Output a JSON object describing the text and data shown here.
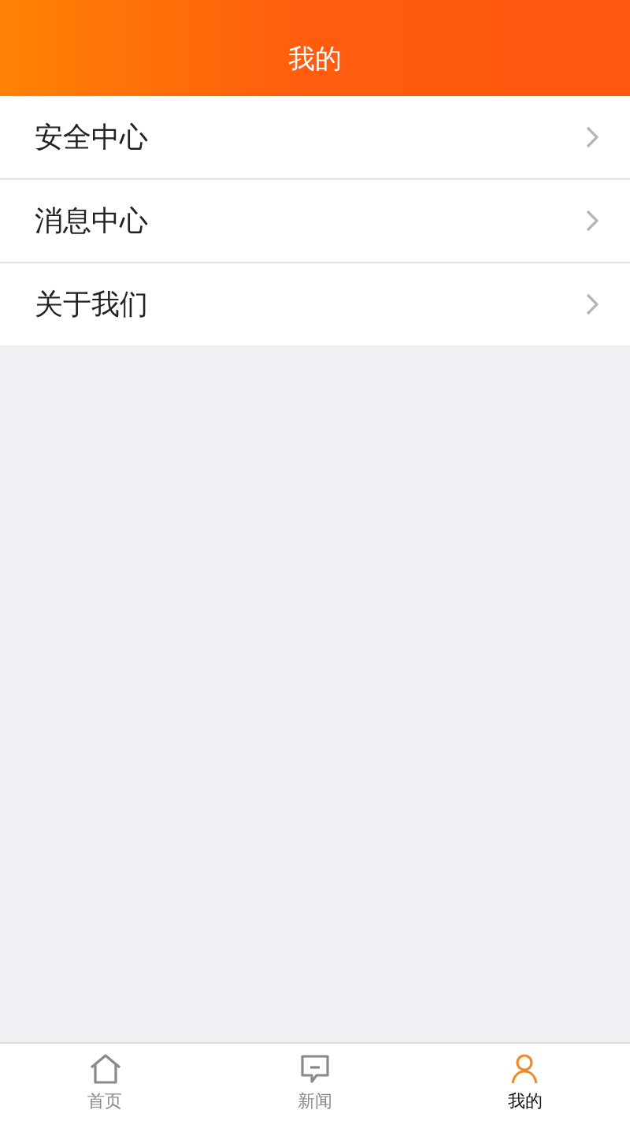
{
  "header": {
    "title": "我的"
  },
  "menu": [
    {
      "label": "安全中心"
    },
    {
      "label": "消息中心"
    },
    {
      "label": "关于我们"
    }
  ],
  "tabbar": [
    {
      "kind": "home",
      "label": "首页",
      "selected": false
    },
    {
      "kind": "news",
      "label": "新闻",
      "selected": false
    },
    {
      "kind": "profile",
      "label": "我的",
      "selected": true
    }
  ]
}
